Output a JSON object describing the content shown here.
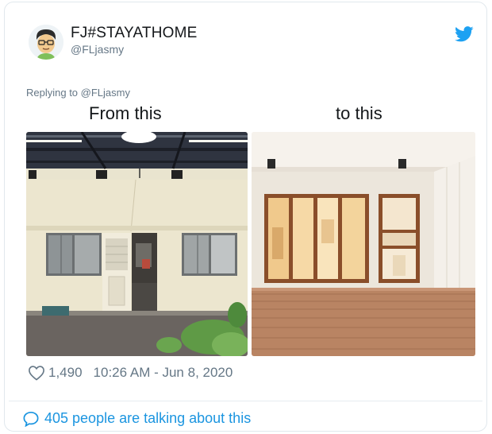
{
  "tweet": {
    "display_name": "FJ#STAYATHOME",
    "handle": "@FLjasmy",
    "reply_prefix": "Replying to",
    "reply_handle": "@FLjasmy",
    "caption_left": "From this",
    "caption_right": "to this",
    "likes": "1,490",
    "timestamp": "10:26 AM - Jun 8, 2020",
    "talking": "405 people are talking about this"
  },
  "icons": {
    "brand": "twitter-bird-icon",
    "like": "heart-icon",
    "conversation": "speech-bubble-icon"
  },
  "colors": {
    "accent": "#1da1f2",
    "link": "#1b95e0",
    "muted": "#657786",
    "text": "#14171a"
  }
}
